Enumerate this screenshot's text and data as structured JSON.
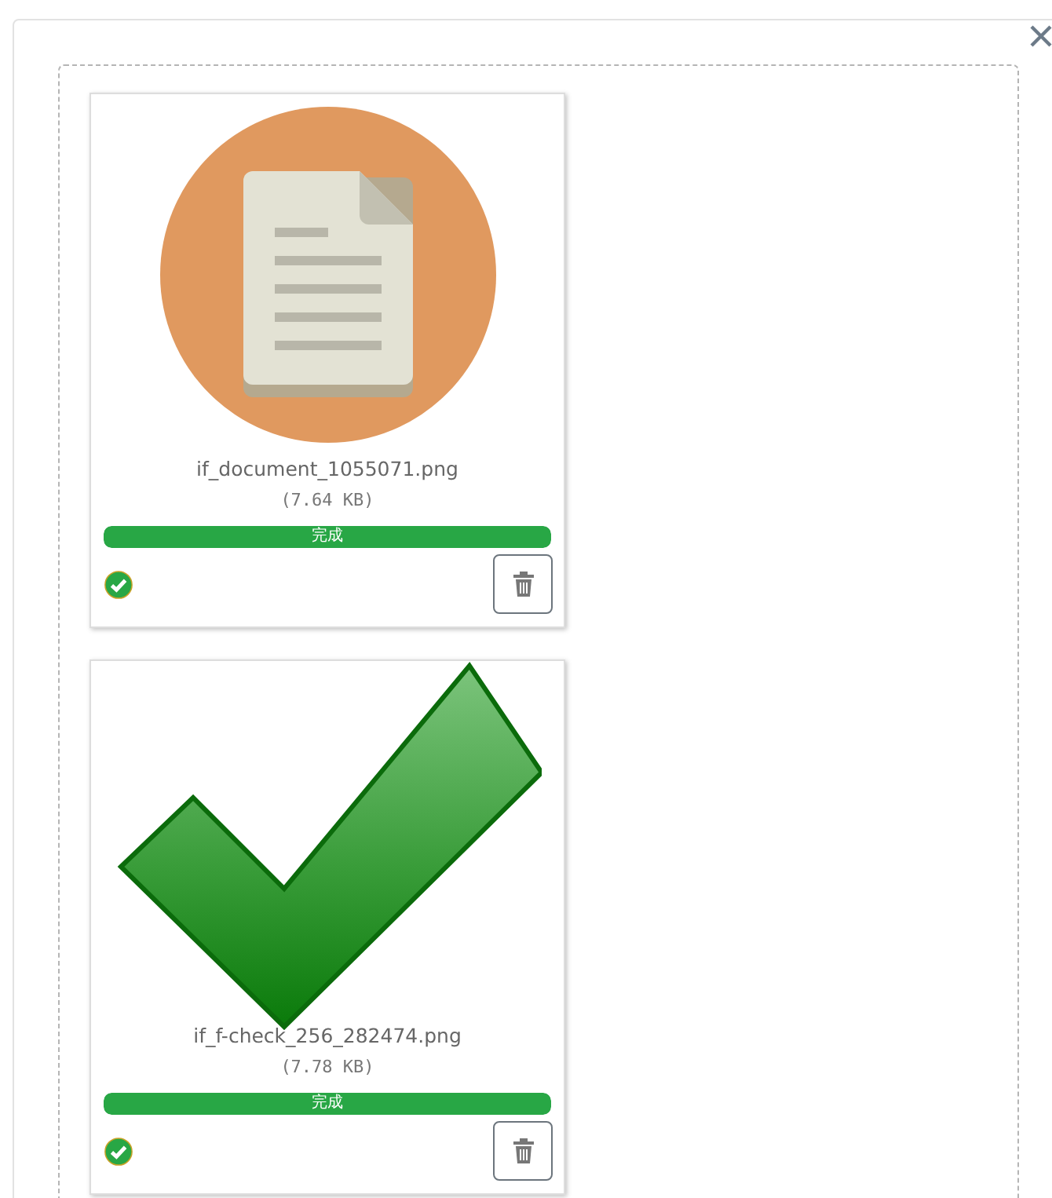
{
  "files": [
    {
      "kind": "document",
      "name": "if_document_1055071.png",
      "size": "(7.64 KB)",
      "progress": {
        "level": 1,
        "label": "完成"
      },
      "complete": true
    },
    {
      "kind": "check",
      "name": "if_f-check_256_282474.png",
      "size": "(7.78 KB)",
      "progress": {
        "level": 1,
        "label": "完成"
      },
      "complete": true
    }
  ]
}
